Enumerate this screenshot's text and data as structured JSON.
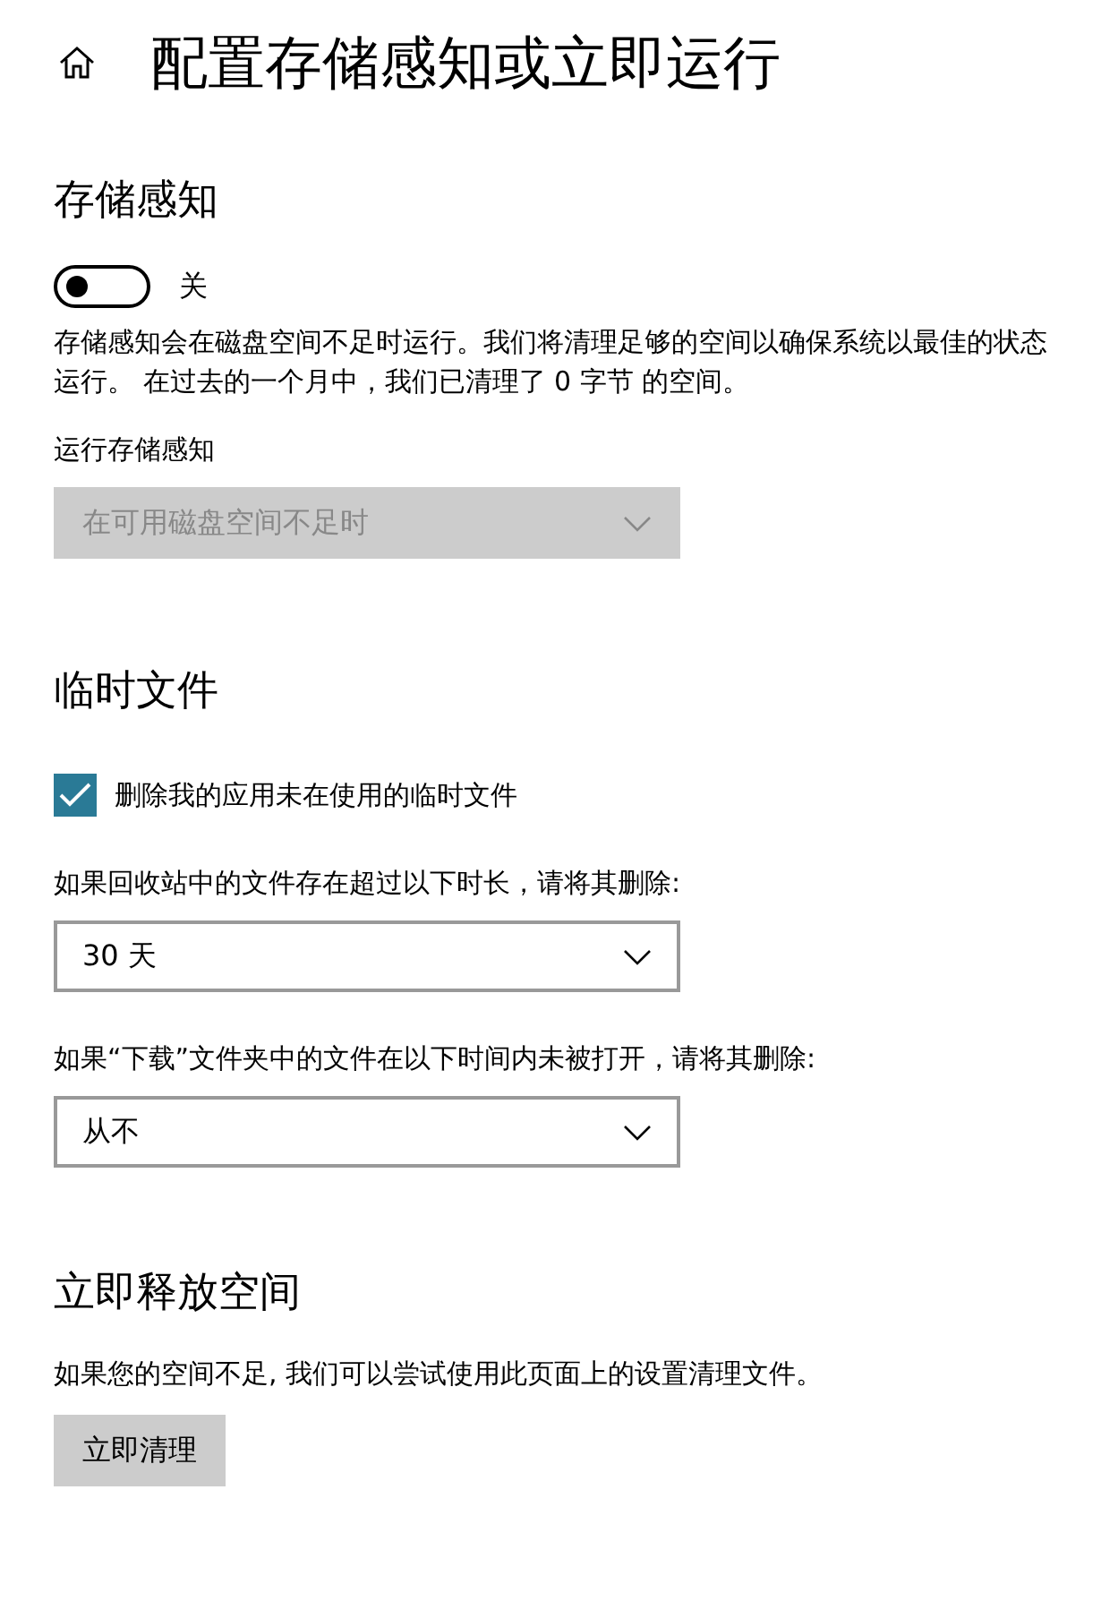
{
  "header": {
    "title": "配置存储感知或立即运行"
  },
  "storage_sense": {
    "heading": "存储感知",
    "toggle": {
      "on": false,
      "label": "关"
    },
    "description": "存储感知会在磁盘空间不足时运行。我们将清理足够的空间以确保系统以最佳的状态运行。 在过去的一个月中，我们已清理了 0 字节 的空间。",
    "run_label": "运行存储感知",
    "run_dropdown": {
      "value": "在可用磁盘空间不足时",
      "disabled": true
    }
  },
  "temp_files": {
    "heading": "临时文件",
    "checkbox": {
      "label": "删除我的应用未在使用的临时文件",
      "checked": true
    },
    "settings": [
      {
        "label": "如果回收站中的文件存在超过以下时长，请将其删除:",
        "value": "30 天",
        "disabled": false
      },
      {
        "label": "如果“下载”文件夹中的文件在以下时间内未被打开，请将其删除:",
        "value": "从不",
        "disabled": false
      }
    ]
  },
  "free_space": {
    "heading": "立即释放空间",
    "description": "如果您的空间不足, 我们可以尝试使用此页面上的设置清理文件。",
    "button": "立即清理"
  }
}
